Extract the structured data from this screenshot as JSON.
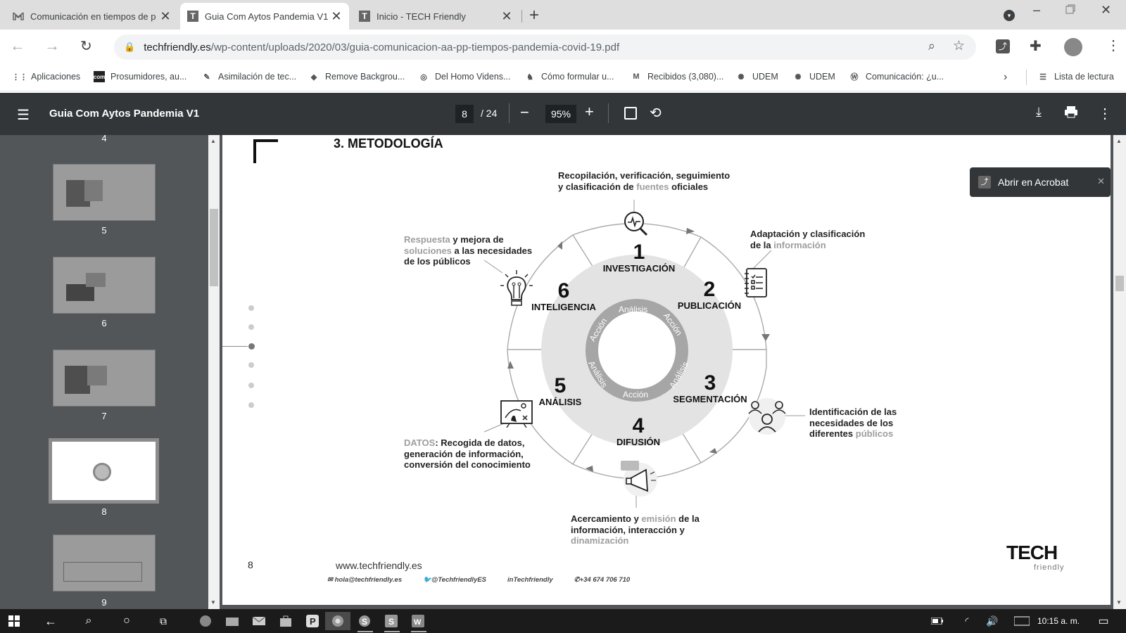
{
  "browser": {
    "tabs": [
      {
        "title": "Comunicación en tiempos de p",
        "favicon": "gmail-icon",
        "active": false
      },
      {
        "title": "Guia Com Aytos Pandemia V1",
        "favicon": "T",
        "active": true
      },
      {
        "title": "Inicio - TECH Friendly",
        "favicon": "T",
        "active": false
      }
    ],
    "new_tab": "+",
    "url": {
      "domain": "techfriendly.es",
      "path": "/wp-content/uploads/2020/03/guia-comunicacion-aa-pp-tiempos-pandemia-covid-19.pdf"
    },
    "bookmarks": [
      {
        "label": "Aplicaciones",
        "icon": "apps-grid-icon"
      },
      {
        "label": "Prosumidores, au...",
        "icon": "com"
      },
      {
        "label": "Asimilación de tec...",
        "icon": "pen-icon"
      },
      {
        "label": "Remove Backgrou...",
        "icon": "layers-icon"
      },
      {
        "label": "Del Homo Videns...",
        "icon": "circle-icon"
      },
      {
        "label": "Cómo formular u...",
        "icon": "elephant-icon"
      },
      {
        "label": "Recibidos (3,080)...",
        "icon": "gmail-icon"
      },
      {
        "label": "UDEM",
        "icon": "udem-icon"
      },
      {
        "label": "UDEM",
        "icon": "udem-icon"
      },
      {
        "label": "Comunicación: ¿u...",
        "icon": "wordpress-icon"
      }
    ],
    "reading_list": "Lista de lectura"
  },
  "pdf": {
    "title": "Guia Com Aytos Pandemia V1",
    "current_page": "8",
    "total_pages": "/ 24",
    "zoom": "95%",
    "thumbnails": [
      {
        "num": "4",
        "selected": false
      },
      {
        "num": "5",
        "selected": false
      },
      {
        "num": "6",
        "selected": false
      },
      {
        "num": "7",
        "selected": false
      },
      {
        "num": "8",
        "selected": true
      },
      {
        "num": "9",
        "selected": false
      }
    ],
    "acrobat_popup": "Abrir en Acrobat"
  },
  "document": {
    "heading": "3. METODOLOGÍA",
    "stages": [
      {
        "num": "1",
        "label": "INVESTIGACIÓN"
      },
      {
        "num": "2",
        "label": "PUBLICACIÓN"
      },
      {
        "num": "3",
        "label": "SEGMENTACIÓN"
      },
      {
        "num": "4",
        "label": "DIFUSIÓN"
      },
      {
        "num": "5",
        "label": "ANÁLISIS"
      },
      {
        "num": "6",
        "label": "INTELIGENCIA"
      }
    ],
    "ring_words": {
      "analisis": "Análisis",
      "accion": "Acción"
    },
    "annotations": {
      "research_a": "Recopilación, verificación, seguimiento",
      "research_b": "y clasificación de ",
      "research_g": "fuentes",
      "research_c": " oficiales",
      "publish_a": "Adaptación y clasificación",
      "publish_b": "de la ",
      "publish_g": "información",
      "segment_a": "Identificación de las",
      "segment_b": "necesidades de los",
      "segment_c": "diferentes ",
      "segment_g": "públicos",
      "diffusion_a": "Acercamiento y ",
      "diffusion_g1": "emisión",
      "diffusion_b": " de la",
      "diffusion_c": "información, interacción y",
      "diffusion_g2": "dinamización",
      "analysis_g": "DATOS",
      "analysis_a": ": Recogida de datos,",
      "analysis_b": "generación de información,",
      "analysis_c": "conversión del conocimiento",
      "intel_g1": "Respuesta",
      "intel_a": " y mejora de",
      "intel_g2": "soluciones",
      "intel_b": " a las necesidades",
      "intel_c": "de los públicos"
    },
    "page_number": "8",
    "website": "www.techfriendly.es",
    "footer_contacts": {
      "email": "hola@techfriendly.es",
      "twitter": "@TechfriendlyES",
      "linkedin": "Techfriendly",
      "phone": "+34 674 706 710"
    },
    "logo_main": "TECH",
    "logo_sub": "friendly"
  },
  "taskbar": {
    "time": "10:15 a. m."
  }
}
